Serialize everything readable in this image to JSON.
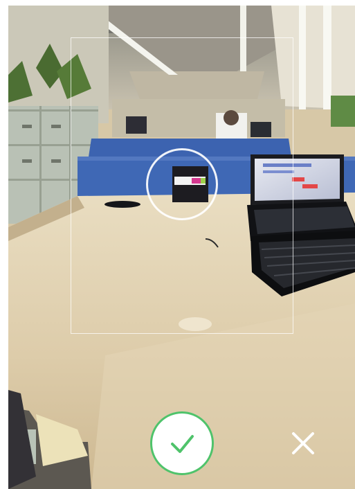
{
  "camera": {
    "accent_color": "#4fc36b",
    "overlay_color": "#ffffff"
  },
  "controls": {
    "confirm_icon": "check-icon",
    "close_icon": "close-icon"
  }
}
